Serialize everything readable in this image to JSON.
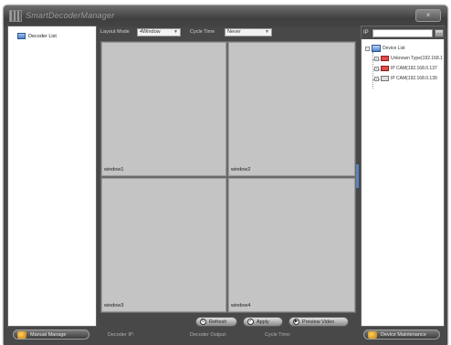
{
  "window": {
    "title": "SmartDecoderManager",
    "close_label": "×"
  },
  "left_panel": {
    "tree_items": [
      {
        "label": "Decoder List"
      }
    ],
    "bottom_button_label": "Manual Manage"
  },
  "toolbar": {
    "layout_mode_label": "Layout Mode",
    "layout_mode_value": "4Window",
    "cycle_time_label": "Cycle Time",
    "cycle_time_value": "Never"
  },
  "grid": {
    "windows": [
      {
        "label": "window1"
      },
      {
        "label": "window2"
      },
      {
        "label": "window3"
      },
      {
        "label": "window4"
      }
    ]
  },
  "footer_buttons": {
    "refresh_label": "Refresh",
    "apply_label": "Apply",
    "preview_label": "Preview Video"
  },
  "status_bar": {
    "decoder_ip_label": "Decoder IP:",
    "decoder_output_label": "Decoder Output:",
    "cycle_time_label": "Cycle Time:"
  },
  "right_panel": {
    "search_label": "IP",
    "search_value": "",
    "search_button_label": "...",
    "device_tree": {
      "root_label": "Device List",
      "children": [
        {
          "label": "Unknown Type(192.168.1",
          "status": "red"
        },
        {
          "label": "IP CAM(192.168.0.137",
          "status": "red"
        },
        {
          "label": "IP CAM(192.168.0.139",
          "status": "gray"
        }
      ]
    },
    "bottom_button_label": "Device Maintenance"
  },
  "colors": {
    "frame": "#484848",
    "window_cell": "#c4c4c4",
    "accent_blue": "#5c82c2"
  }
}
